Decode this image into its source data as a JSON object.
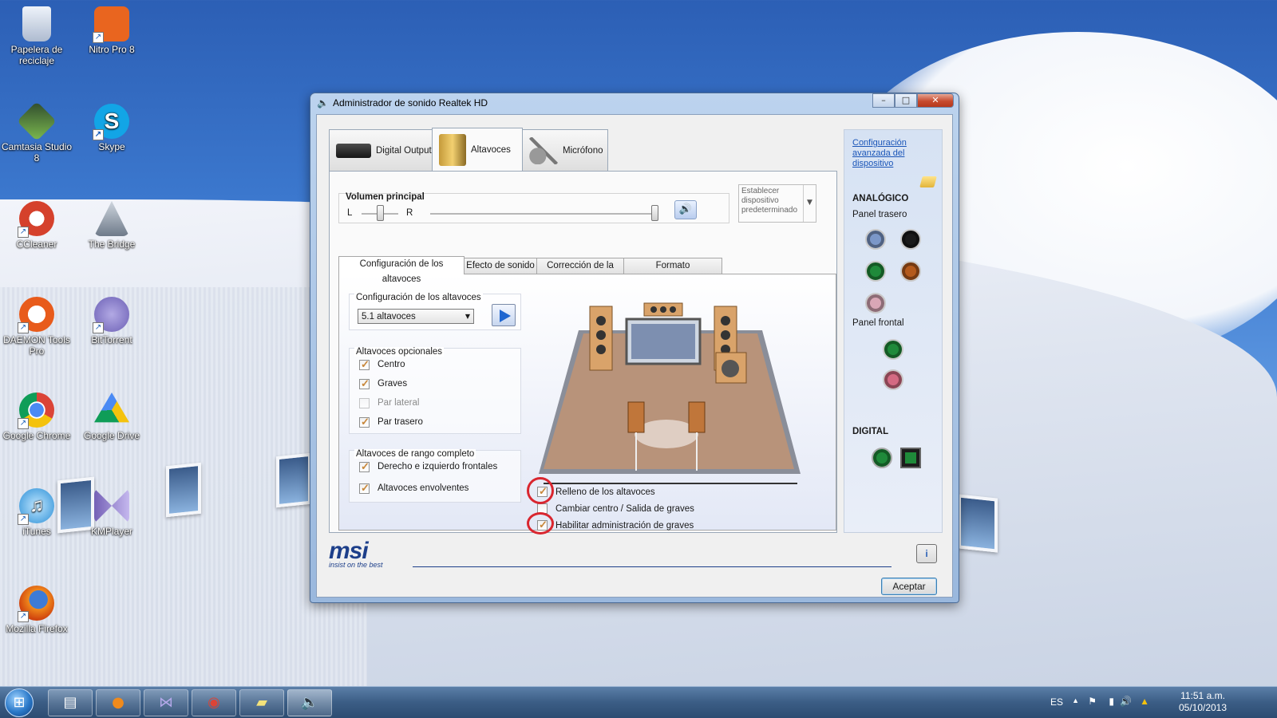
{
  "desktop": {
    "icons": [
      {
        "label": "Papelera de reciclaje",
        "color": "#cfd8e6"
      },
      {
        "label": "Nitro Pro 8",
        "color": "#e9651f"
      },
      {
        "label": "Camtasia Studio 8",
        "color": "#3c5a3a"
      },
      {
        "label": "Skype",
        "color": "#12a5e6"
      },
      {
        "label": "CCleaner",
        "color": "#d5412c"
      },
      {
        "label": "The Bridge",
        "color": "#8d98a6"
      },
      {
        "label": "DAEMON Tools Pro",
        "color": "#e85b1b"
      },
      {
        "label": "BitTorrent",
        "color": "#6b5fb5"
      },
      {
        "label": "Google Chrome",
        "color": "#3aa757"
      },
      {
        "label": "Google Drive",
        "color": "#f4c20d"
      },
      {
        "label": "iTunes",
        "color": "#3aa0e0"
      },
      {
        "label": "KMPlayer",
        "color": "#7460b6"
      },
      {
        "label": "Mozilla Firefox",
        "color": "#e66000"
      }
    ]
  },
  "window": {
    "title": "Administrador de sonido Realtek HD",
    "tabs": [
      {
        "label": "Digital Output",
        "selected": false
      },
      {
        "label": "Altavoces",
        "selected": true
      },
      {
        "label": "Micrófono",
        "selected": false
      }
    ],
    "volume": {
      "label": "Volumen principal",
      "left": "L",
      "right": "R",
      "balance_fraction": 0.5,
      "level_fraction": 1.0
    },
    "default_device_label": "Establecer dispositivo predeterminado",
    "subtabs": [
      {
        "label": "Configuración de los altavoces",
        "selected": true
      },
      {
        "label": "Efecto de sonido",
        "selected": false
      },
      {
        "label": "Corrección de la sala",
        "selected": false
      },
      {
        "label": "Formato predeterminado",
        "selected": false
      }
    ],
    "speaker_config": {
      "group_label": "Configuración de los altavoces",
      "selected": "5.1 altavoces"
    },
    "optional_speakers": {
      "group_label": "Altavoces opcionales",
      "items": [
        {
          "label": "Centro",
          "checked": true,
          "enabled": true
        },
        {
          "label": "Graves",
          "checked": true,
          "enabled": true
        },
        {
          "label": "Par lateral",
          "checked": false,
          "enabled": false
        },
        {
          "label": "Par trasero",
          "checked": true,
          "enabled": true
        }
      ]
    },
    "fullrange": {
      "group_label": "Altavoces de rango completo",
      "items": [
        {
          "label": "Derecho e izquierdo frontales",
          "checked": true
        },
        {
          "label": "Altavoces envolventes",
          "checked": true
        }
      ]
    },
    "options": [
      {
        "label": "Relleno de los altavoces",
        "checked": true
      },
      {
        "label": "Cambiar centro / Salida de graves",
        "checked": false
      },
      {
        "label": "Habilitar administración de graves",
        "checked": true
      }
    ],
    "advanced_link": "Configuración avanzada del dispositivo",
    "analog": {
      "title": "ANALÓGICO",
      "rear_label": "Panel trasero",
      "rear_jacks": [
        "#7b97c8",
        "#1a1a1a",
        "#1f8a3a",
        "#b45a1c",
        "#d9a7b6"
      ],
      "front_label": "Panel frontal",
      "front_jacks": [
        "#1f8a3a",
        "#d46a82"
      ]
    },
    "digital": {
      "title": "DIGITAL"
    },
    "brand": "msi",
    "brand_tagline": "insist on the best",
    "ok_button": "Aceptar"
  },
  "taskbar": {
    "language": "ES",
    "time": "11:51 a.m.",
    "date": "05/10/2013"
  }
}
